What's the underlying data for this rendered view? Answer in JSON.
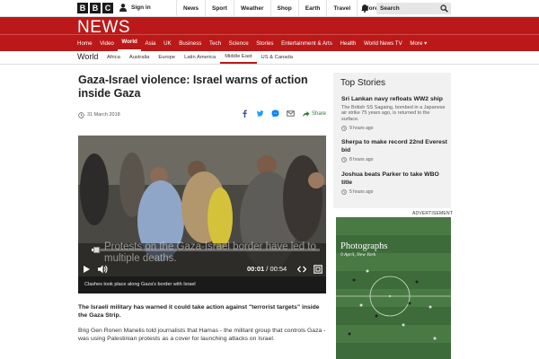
{
  "topbar": {
    "logo_letters": [
      "B",
      "B",
      "C"
    ],
    "signin": "Sign in",
    "nav": [
      "News",
      "Sport",
      "Weather",
      "Shop",
      "Earth",
      "Travel",
      "More"
    ],
    "search_label": "Search"
  },
  "news": {
    "title": "NEWS",
    "nav": [
      "Home",
      "Video",
      "World",
      "Asia",
      "UK",
      "Business",
      "Tech",
      "Science",
      "Stories",
      "Entertainment & Arts",
      "Health",
      "World News TV",
      "More"
    ],
    "active": "World"
  },
  "subnav": {
    "section": "World",
    "items": [
      "Africa",
      "Australia",
      "Europe",
      "Latin America",
      "Middle East",
      "US & Canada"
    ],
    "active": "Middle East"
  },
  "article": {
    "headline": "Gaza-Israel violence: Israel warns of action inside Gaza",
    "date": "31 March 2018",
    "share_label": "Share",
    "video": {
      "overlay_text": "Protests on the Gaza-Israel border have led to multiple deaths.",
      "current_time": "00:01",
      "duration": "/ 00:54",
      "progress_fraction": 0.02
    },
    "caption": "Clashes took place along Gaza's border with Israel",
    "lede": "The Israeli military has warned it could take action against \"terrorist targets\" inside the Gaza Strip.",
    "paragraph": "Brig Gen Ronen Manelis told journalists that Hamas - the militant group that controls Gaza - was using Palestinian protests as a cover for launching attacks on Israel."
  },
  "sidebar": {
    "title": "Top Stories",
    "stories": [
      {
        "headline": "Sri Lankan navy refloats WW2 ship",
        "summary": "The British SS Sagaing, bombed in a Japanese air strike 75 years ago, is returned to the surface.",
        "time": "9 hours ago"
      },
      {
        "headline": "Sherpa to make record 22nd Everest bid",
        "summary": "",
        "time": "8 hours ago"
      },
      {
        "headline": "Joshua beats Parker to take WBO title",
        "summary": "",
        "time": "5 hours ago"
      }
    ],
    "ad_label": "ADVERTISEMENT",
    "ad_title": "Photographs",
    "ad_date": "9 April, New York"
  },
  "colors": {
    "news_red": "#bb1919",
    "share_green": "#2a7a3a",
    "facebook": "#3b5998",
    "twitter": "#1da1f2",
    "messenger": "#0084ff"
  }
}
